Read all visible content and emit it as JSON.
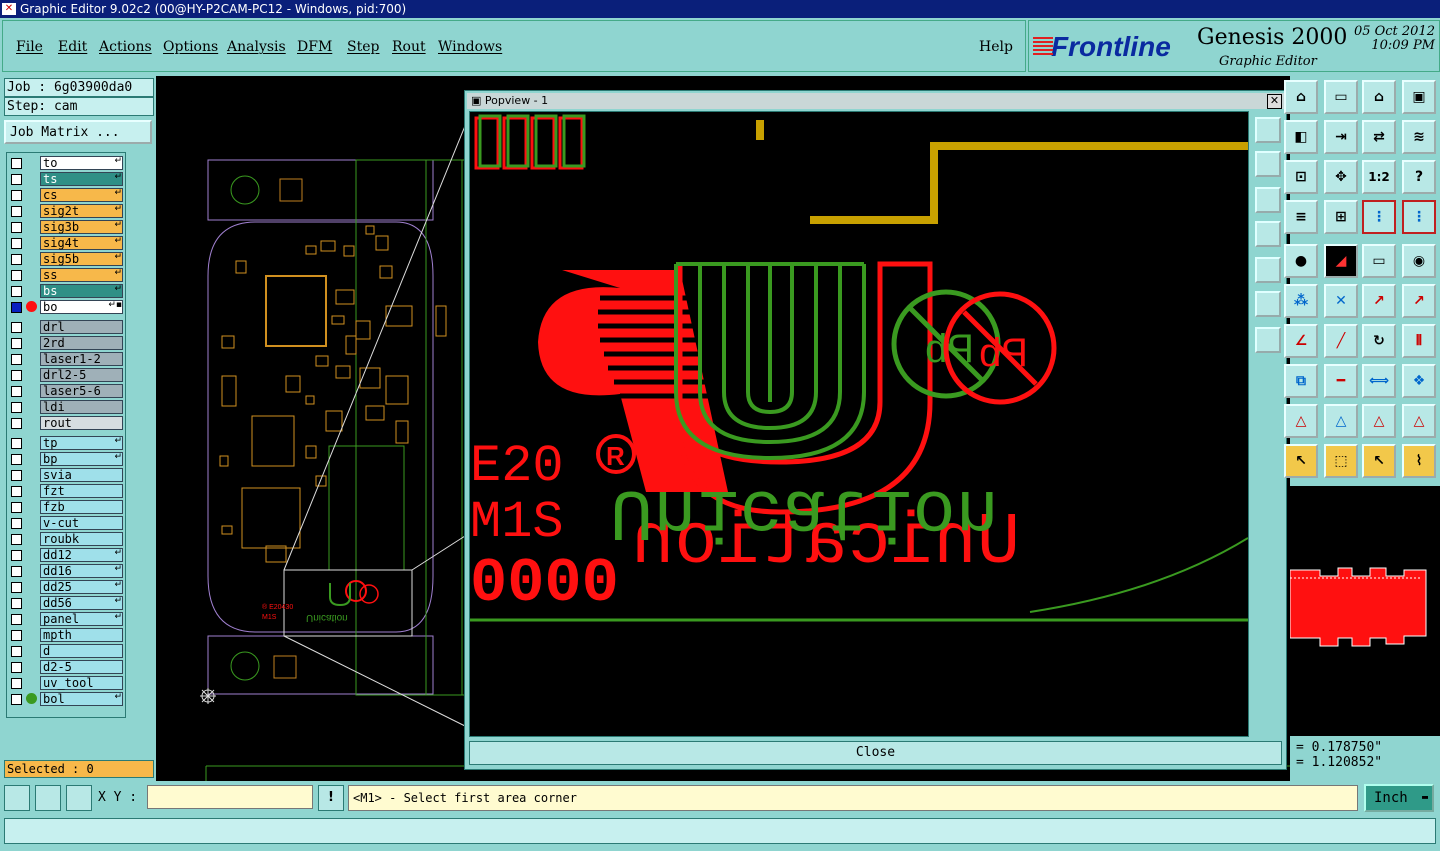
{
  "window": {
    "title": "Graphic Editor 9.02c2 (00@HY-P2CAM-PC12 - Windows, pid:700)"
  },
  "menu": [
    "File",
    "Edit",
    "Actions",
    "Options",
    "Analysis",
    "DFM",
    "Step",
    "Rout",
    "Windows"
  ],
  "help": "Help",
  "brand": {
    "logo": "Frontline",
    "product": "Genesis 2000",
    "subtitle": "Graphic Editor",
    "date": "05 Oct 2012",
    "time": "10:09 PM"
  },
  "job": {
    "job_label": "Job : 6g03900da0",
    "step_label": "Step: cam",
    "matrix_button": "Job Matrix ..."
  },
  "layers": [
    {
      "name": "to",
      "color": "white",
      "mark": "↵"
    },
    {
      "name": "ts",
      "color": "teal",
      "mark": "↵"
    },
    {
      "name": "cs",
      "color": "orange",
      "mark": "↵"
    },
    {
      "name": "sig2t",
      "color": "orange",
      "mark": "↵"
    },
    {
      "name": "sig3b",
      "color": "orange",
      "mark": "↵"
    },
    {
      "name": "sig4t",
      "color": "orange",
      "mark": "↵"
    },
    {
      "name": "sig5b",
      "color": "orange",
      "mark": "↵"
    },
    {
      "name": "ss",
      "color": "orange",
      "mark": "↵"
    },
    {
      "name": "bs",
      "color": "teal",
      "mark": "↵"
    },
    {
      "name": "bo",
      "color": "white",
      "mark": "↵▪",
      "active": true
    },
    {
      "name": "drl",
      "color": "grey"
    },
    {
      "name": "2rd",
      "color": "grey"
    },
    {
      "name": "laser1-2",
      "color": "grey"
    },
    {
      "name": "drl2-5",
      "color": "grey"
    },
    {
      "name": "laser5-6",
      "color": "grey"
    },
    {
      "name": "ldi",
      "color": "grey"
    },
    {
      "name": "rout",
      "color": "light"
    },
    {
      "name": "tp",
      "color": "cyan",
      "mark": "↵"
    },
    {
      "name": "bp",
      "color": "cyan",
      "mark": "↵"
    },
    {
      "name": "svia",
      "color": "cyan"
    },
    {
      "name": "fzt",
      "color": "cyan"
    },
    {
      "name": "fzb",
      "color": "cyan"
    },
    {
      "name": "v-cut",
      "color": "cyan"
    },
    {
      "name": "roubk",
      "color": "cyan"
    },
    {
      "name": "dd12",
      "color": "cyan",
      "mark": "↵"
    },
    {
      "name": "dd16",
      "color": "cyan",
      "mark": "↵"
    },
    {
      "name": "dd25",
      "color": "cyan",
      "mark": "↵"
    },
    {
      "name": "dd56",
      "color": "cyan",
      "mark": "↵"
    },
    {
      "name": "panel",
      "color": "cyan",
      "mark": "↵"
    },
    {
      "name": "mpth",
      "color": "cyan"
    },
    {
      "name": "d",
      "color": "cyan"
    },
    {
      "name": "d2-5",
      "color": "cyan"
    },
    {
      "name": "uv_tool",
      "color": "cyan"
    },
    {
      "name": "bol",
      "color": "cyan",
      "mark": "↵"
    }
  ],
  "selected": "Selected : 0",
  "popview": {
    "title": "Popview - 1",
    "close": "Close",
    "board_text_1": "Unication",
    "board_text_2": "E20",
    "board_text_3": "M1S",
    "board_text_4": "0000"
  },
  "coords": {
    "x": "= 0.178750\"",
    "y": "= 1.120852\""
  },
  "bottom": {
    "xy_label": "X Y :",
    "xy_value": "",
    "prompt": "<M1> - Select first area corner",
    "unit": "Inch"
  },
  "colors": {
    "bg": "#8fd5d0",
    "orange": "#f7b84a",
    "teal": "#2f8f86",
    "red": "#ff1010",
    "green": "#3a9a20",
    "gold": "#c8a000"
  }
}
